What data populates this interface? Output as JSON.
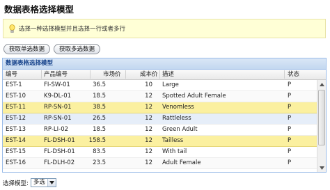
{
  "page_title": "数据表格选择模型",
  "tip_text": "选择一种选择模型并且选择一行或者多行",
  "buttons": {
    "get_single": "获取单选数据",
    "get_multi": "获取多选数据"
  },
  "grid": {
    "title": "数据表格选择模型",
    "columns": [
      "编号",
      "产品编号",
      "市场价",
      "成本价",
      "描述",
      "状态"
    ],
    "rows": [
      {
        "id": "EST-1",
        "product": "FI-SW-01",
        "market": "36.5",
        "cost": "10",
        "desc": "Large",
        "status": "P",
        "state": "normal"
      },
      {
        "id": "EST-10",
        "product": "K9-DL-01",
        "market": "18.5",
        "cost": "12",
        "desc": "Spotted Adult Female",
        "status": "P",
        "state": "alt"
      },
      {
        "id": "EST-11",
        "product": "RP-SN-01",
        "market": "38.5",
        "cost": "12",
        "desc": "Venomless",
        "status": "P",
        "state": "sel"
      },
      {
        "id": "EST-12",
        "product": "RP-SN-01",
        "market": "26.5",
        "cost": "12",
        "desc": "Rattleless",
        "status": "P",
        "state": "hover"
      },
      {
        "id": "EST-13",
        "product": "RP-LI-02",
        "market": "18.5",
        "cost": "12",
        "desc": "Green Adult",
        "status": "P",
        "state": "normal"
      },
      {
        "id": "EST-14",
        "product": "FL-DSH-01",
        "market": "158.5",
        "cost": "12",
        "desc": "Tailless",
        "status": "P",
        "state": "sel"
      },
      {
        "id": "EST-15",
        "product": "FL-DSH-01",
        "market": "83.5",
        "cost": "12",
        "desc": "With tail",
        "status": "P",
        "state": "normal"
      },
      {
        "id": "EST-16",
        "product": "FL-DLH-02",
        "market": "23.5",
        "cost": "12",
        "desc": "Adult Female",
        "status": "P",
        "state": "alt"
      }
    ]
  },
  "selection_mode": {
    "label": "选择模型:",
    "value": "多选"
  },
  "colors": {
    "selected_row": "#fbf0a0",
    "hover_row": "#e6eef9",
    "header_blue": "#15428b",
    "tip_bg": "#ffffd6"
  },
  "icons": {
    "tip": "lightbulb-icon",
    "scroll_up": "arrow-up-icon",
    "scroll_down": "arrow-down-icon",
    "dropdown": "chevron-down-icon"
  }
}
